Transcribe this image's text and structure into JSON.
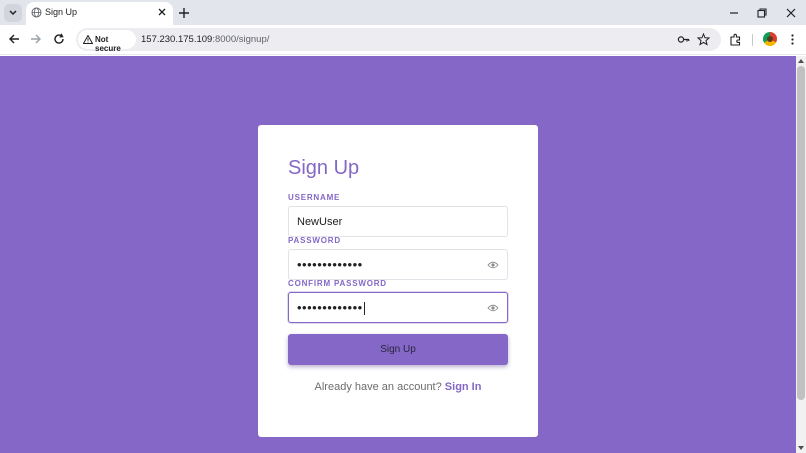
{
  "browser": {
    "tab_title": "Sign Up",
    "security_chip": "Not secure",
    "url_host": "157.230.175.109",
    "url_rest": ":8000/signup/"
  },
  "form": {
    "title": "Sign Up",
    "username_label": "USERNAME",
    "username_value": "NewUser",
    "password_label": "PASSWORD",
    "password_masked": "•••••••••••••",
    "confirm_label": "CONFIRM PASSWORD",
    "confirm_masked": "•••••••••••••",
    "submit_label": "Sign Up",
    "signin_prompt": "Already have an account?",
    "signin_link": "Sign In"
  },
  "icons": {
    "tab_search": "chevron-down-icon",
    "favicon": "globe-icon",
    "tab_close": "close-icon",
    "new_tab": "plus-icon",
    "back": "arrow-left-icon",
    "forward": "arrow-right-icon",
    "reload": "reload-icon",
    "security": "warning-icon",
    "password_manager": "key-icon",
    "bookmark": "star-icon",
    "extensions": "puzzle-icon",
    "menu": "kebab-menu-icon",
    "show_password": "eye-icon"
  },
  "colors": {
    "accent": "#8467c6",
    "page_background": "#8467c6",
    "card": "#ffffff"
  }
}
